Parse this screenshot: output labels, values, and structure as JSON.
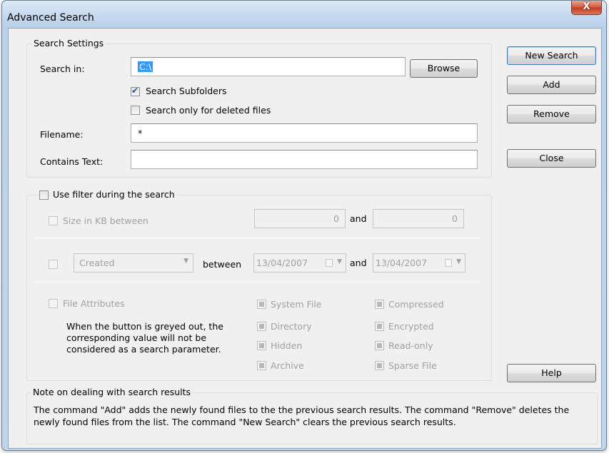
{
  "window": {
    "title": "Advanced Search",
    "close_glyph": "X"
  },
  "search_settings": {
    "legend": "Search Settings",
    "search_in_label": "Search in:",
    "search_in_value": "C:\\",
    "browse_label": "Browse",
    "subfolders_label": "Search Subfolders",
    "subfolders_checked": true,
    "deleted_only_label": "Search only for deleted files",
    "deleted_only_checked": false,
    "filename_label": "Filename:",
    "filename_value": "*",
    "contains_label": "Contains Text:",
    "contains_value": ""
  },
  "filter": {
    "use_filter_label": "Use filter during the search",
    "use_filter_checked": false,
    "size_label": "Size in KB between",
    "size_min": "0",
    "and_label_1": "and",
    "size_max": "0",
    "date_kind": "Created",
    "between_label": "between",
    "date_from": "13/04/2007",
    "and_label_2": "and",
    "date_to": "13/04/2007",
    "attributes_label": "File Attributes",
    "attributes_hint": "When the button is greyed out, the corresponding value will not be considered as a search parameter.",
    "attributes": {
      "system_file": "System File",
      "directory": "Directory",
      "hidden": "Hidden",
      "archive": "Archive",
      "compressed": "Compressed",
      "encrypted": "Encrypted",
      "read_only": "Read-only",
      "sparse_file": "Sparse File"
    }
  },
  "buttons": {
    "new_search": "New Search",
    "add": "Add",
    "remove": "Remove",
    "close": "Close",
    "help": "Help"
  },
  "note": {
    "legend": "Note on dealing with search results",
    "text": "The command \"Add\" adds the newly found files to the the previous search results. The command \"Remove\" deletes the newly found files from the list. The command \"New Search\" clears the previous search results."
  }
}
